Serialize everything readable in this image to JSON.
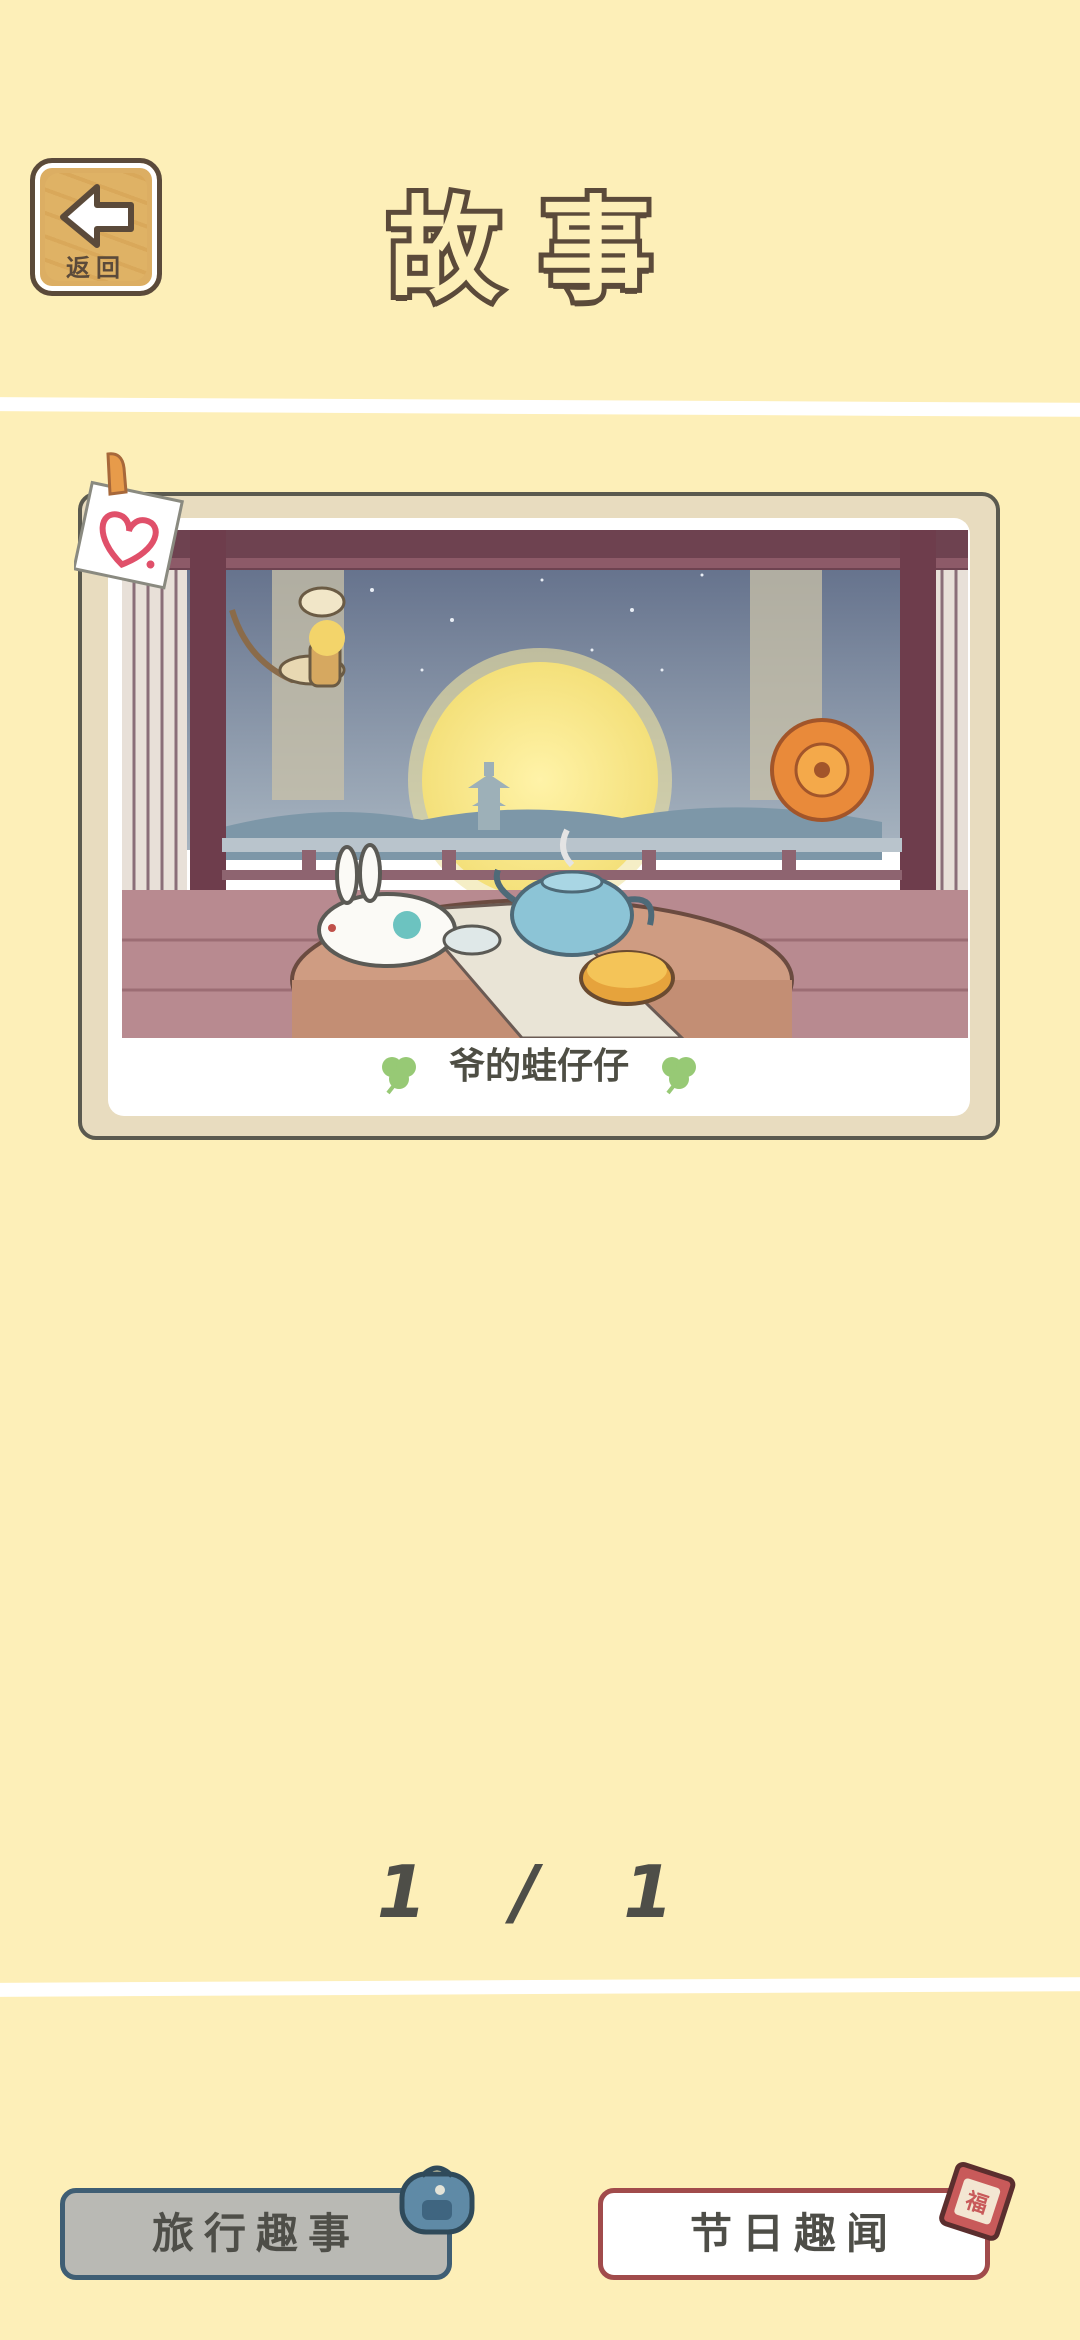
{
  "header": {
    "back_label": "返回",
    "title": "故事"
  },
  "story_card": {
    "caption": "爷的蛙仔仔"
  },
  "pager": {
    "text": "1 / 1"
  },
  "footer": {
    "travel_button": "旅行趣事",
    "holiday_button": "节日趣闻"
  }
}
